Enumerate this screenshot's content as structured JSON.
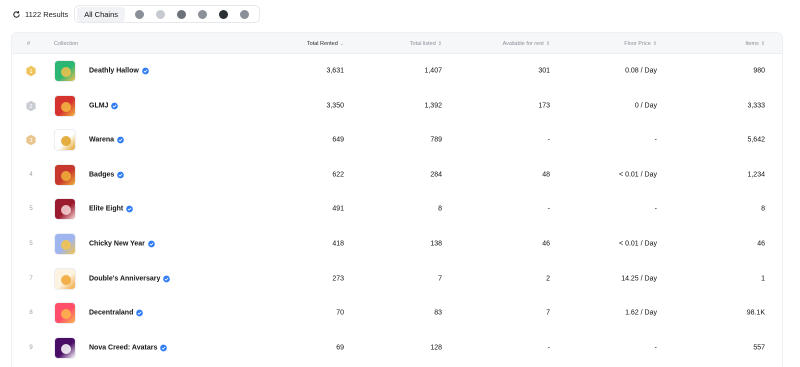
{
  "results": {
    "label": "1122 Results"
  },
  "chains": {
    "all_label": "All Chains",
    "icons": [
      {
        "name": "chain-1-icon",
        "color": "#8a8f98"
      },
      {
        "name": "chain-2-icon",
        "color": "#c7cad1"
      },
      {
        "name": "chain-3-icon",
        "color": "#6b7079"
      },
      {
        "name": "chain-4-icon",
        "color": "#8a8f98"
      },
      {
        "name": "chain-5-icon",
        "color": "#2b2f36"
      },
      {
        "name": "chain-6-icon",
        "color": "#8a8f98"
      }
    ]
  },
  "table": {
    "headers": {
      "rank": "#",
      "collection": "Collection",
      "total_rented": "Total Rented",
      "total_listed": "Total listed",
      "available": "Available for rent",
      "floor": "Floor Price",
      "items": "Items"
    },
    "rows": [
      {
        "rank": "1",
        "medal": "gold",
        "name": "Deathly Hallow",
        "rented": "3,631",
        "listed": "1,407",
        "available": "301",
        "floor": "0.08 / Day",
        "items": "980",
        "thumb": "#2bb673",
        "thumb2": "#f2c14e"
      },
      {
        "rank": "2",
        "medal": "silver",
        "name": "GLMJ",
        "rented": "3,350",
        "listed": "1,392",
        "available": "173",
        "floor": "0 / Day",
        "items": "3,333",
        "thumb": "#d6332f",
        "thumb2": "#f5b942"
      },
      {
        "rank": "3",
        "medal": "bronze",
        "name": "Warena",
        "rented": "649",
        "listed": "789",
        "available": "-",
        "floor": "-",
        "items": "5,642",
        "thumb": "#ffffff",
        "thumb2": "#e0a020"
      },
      {
        "rank": "4",
        "medal": "",
        "name": "Badges",
        "rented": "622",
        "listed": "284",
        "available": "48",
        "floor": "< 0.01 / Day",
        "items": "1,234",
        "thumb": "#c8382c",
        "thumb2": "#f0b23a"
      },
      {
        "rank": "5",
        "medal": "",
        "name": "Elite Eight",
        "rented": "491",
        "listed": "8",
        "available": "-",
        "floor": "-",
        "items": "8",
        "thumb": "#9b1b2e",
        "thumb2": "#f7d7d7"
      },
      {
        "rank": "5",
        "medal": "",
        "name": "Chicky New Year",
        "rented": "418",
        "listed": "138",
        "available": "46",
        "floor": "< 0.01 / Day",
        "items": "46",
        "thumb": "#9fb5f0",
        "thumb2": "#f6c445"
      },
      {
        "rank": "7",
        "medal": "",
        "name": "Double's Anniversary",
        "rented": "273",
        "listed": "7",
        "available": "2",
        "floor": "14.25 / Day",
        "items": "1",
        "thumb": "#fdf3e1",
        "thumb2": "#f1a534"
      },
      {
        "rank": "8",
        "medal": "",
        "name": "Decentraland",
        "rented": "70",
        "listed": "83",
        "available": "7",
        "floor": "1.62 / Day",
        "items": "98.1K",
        "thumb": "#ff4f6a",
        "thumb2": "#ffb74a"
      },
      {
        "rank": "9",
        "medal": "",
        "name": "Nova Creed: Avatars",
        "rented": "69",
        "listed": "128",
        "available": "-",
        "floor": "-",
        "items": "557",
        "thumb": "#4a0d66",
        "thumb2": "#ffffff"
      }
    ]
  }
}
